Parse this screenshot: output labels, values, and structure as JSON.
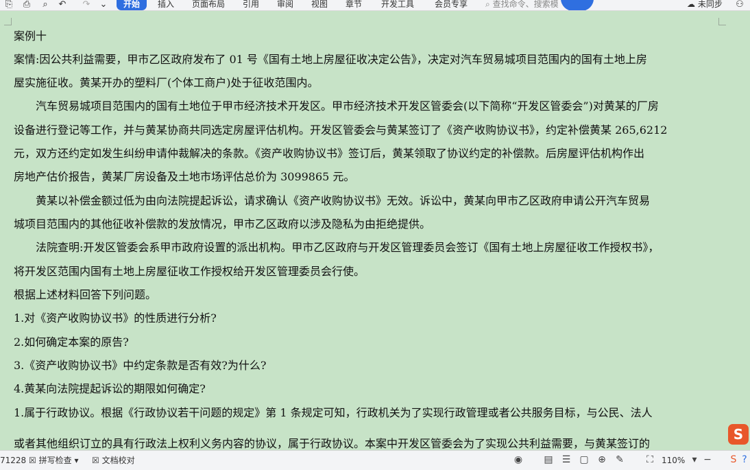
{
  "ribbon": {
    "tabs": [
      "开始",
      "插入",
      "页面布局",
      "引用",
      "审阅",
      "视图",
      "章节",
      "开发工具",
      "会员专享"
    ],
    "active_tab": "开始",
    "search_placeholder": "查找命令、搜索模",
    "sync_label": "未同步",
    "accent_color": "#2f6fe0"
  },
  "document": {
    "lines": [
      "案例十",
      "案情:因公共利益需要，甲市乙区政府发布了 01 号《国有土地上房屋征收决定公告》，决定对汽车贸易城项目范围内的国有土地上房",
      "屋实施征收。黄某开办的塑料厂(个体工商户)处于征收范围内。",
      "汽车贸易城项目范围内的国有土地位于甲市经济技术开发区。甲市经济技术开发区管委会(以下简称“开发区管委会”)对黄某的厂房",
      "设备进行登记等工作，并与黄某协商共同选定房屋评估机构。开发区管委会与黄某签订了《资产收购协议书》，约定补偿黄某 265,6212",
      "元，双方还约定如发生纠纷申请仲裁解决的条款。《资产收购协议书》签订后，黄某领取了协议约定的补偿款。后房屋评估机构作出",
      "房地产估价报告，黄某厂房设备及土地市场评估总价为 3099865 元。",
      "黄某以补偿金额过低为由向法院提起诉讼，请求确认《资产收购协议书》无效。诉讼中，黄某向甲市乙区政府申请公开汽车贸易",
      "城项目范围内的其他征收补偿款的发放情况，甲市乙区政府以涉及隐私为由拒绝提供。",
      "法院查明:开发区管委会系甲市政府设置的派出机构。甲市乙区政府与开发区管理委员会签订《国有土地上房屋征收工作授权书》，",
      "将开发区范围内国有土地上房屋征收工作授权给开发区管理委员会行使。",
      "根据上述材料回答下列问题。",
      "1.对《资产收购协议书》的性质进行分析?",
      "2.如何确定本案的原告?",
      "3.《资产收购协议书》中约定条款是否有效?为什么?",
      "4.黄某向法院提起诉讼的期限如何确定?",
      "1.属于行政协议。根据《行政协议若干问题的规定》第 1 条规定可知，行政机关为了实现行政管理或者公共服务目标，与公民、法人",
      "或者其他组织订立的具有行政法上权利义务内容的协议，属于行政协议。本案中开发区管委会为了实现公共利益需要，与黄某签订的"
    ],
    "background_color": "#c7e3c7"
  },
  "statusbar": {
    "word_count": "71228",
    "spell_check": "拼写检查",
    "doc_proof": "文档校对",
    "zoom": "110%"
  }
}
